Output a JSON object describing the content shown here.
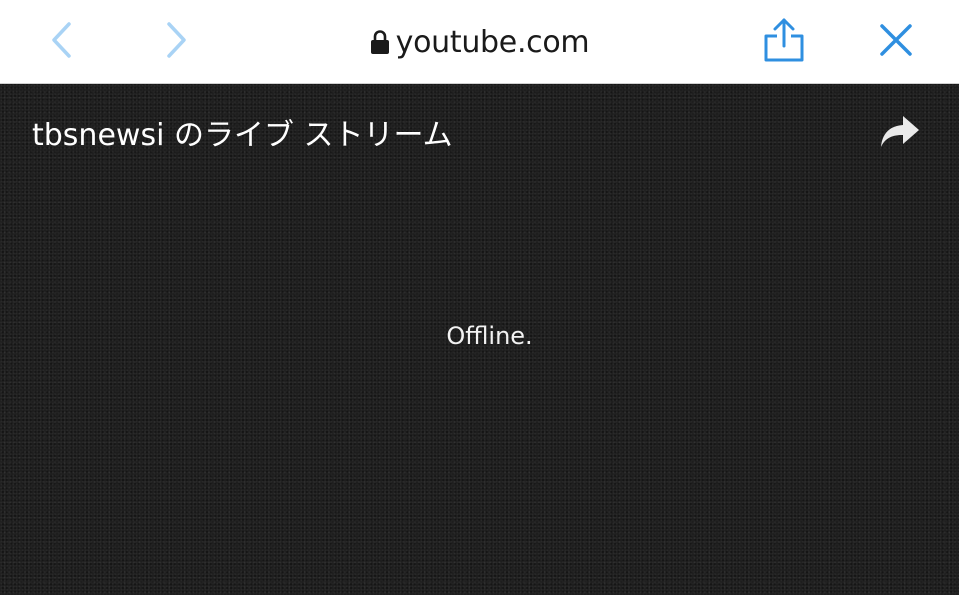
{
  "browser": {
    "url": "youtube.com",
    "accent_color": "#2f8fe0",
    "back_icon": "chevron-left-icon",
    "forward_icon": "chevron-right-icon",
    "lock_icon": "lock-icon",
    "share_icon": "share-icon",
    "close_icon": "close-icon"
  },
  "player": {
    "title": "tbsnewsi のライブ ストリーム",
    "status": "Offline.",
    "share_icon": "share-arrow-icon",
    "background_color": "#1c1c1c"
  }
}
